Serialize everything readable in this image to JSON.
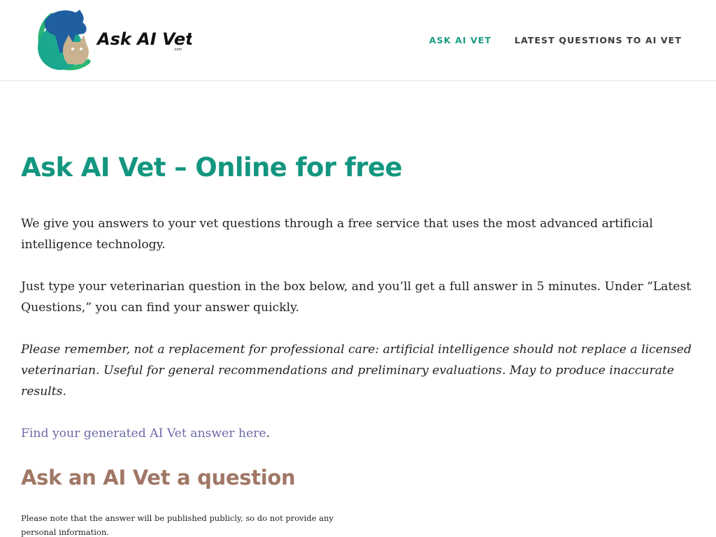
{
  "brand": {
    "logo_text": "Ask AI Vet",
    "logo_subtext": ".com",
    "colors": {
      "teal": "#13967f",
      "green": "#2bb673",
      "blue": "#1f5fa0",
      "tan": "#c9b28f",
      "heading_brown": "#a07766",
      "link_purple": "#6b6aa8"
    }
  },
  "nav": {
    "items": [
      {
        "label": "ASK AI VET",
        "active": true
      },
      {
        "label": "LATEST QUESTIONS TO AI VET",
        "active": false
      }
    ]
  },
  "main": {
    "title": "Ask AI Vet – Online for free",
    "paragraphs": [
      "We give you answers to your vet questions through a free service that uses the most advanced artificial intelligence technology.",
      "Just type your veterinarian question in the box below, and you’ll get a full answer in 5 minutes. Under “Latest Questions,” you can find your answer quickly.",
      "Please remember, not a replacement for professional care: artificial intelligence should not replace a licensed veterinarian. Useful for general recommendations and preliminary evaluations. May to produce inaccurate results."
    ],
    "answer_link": {
      "label": "Find your generated AI Vet answer here",
      "suffix": "."
    },
    "section_title": "Ask an AI Vet a question",
    "note": "Please note that the answer will be published publicly, so do not provide any personal information."
  }
}
